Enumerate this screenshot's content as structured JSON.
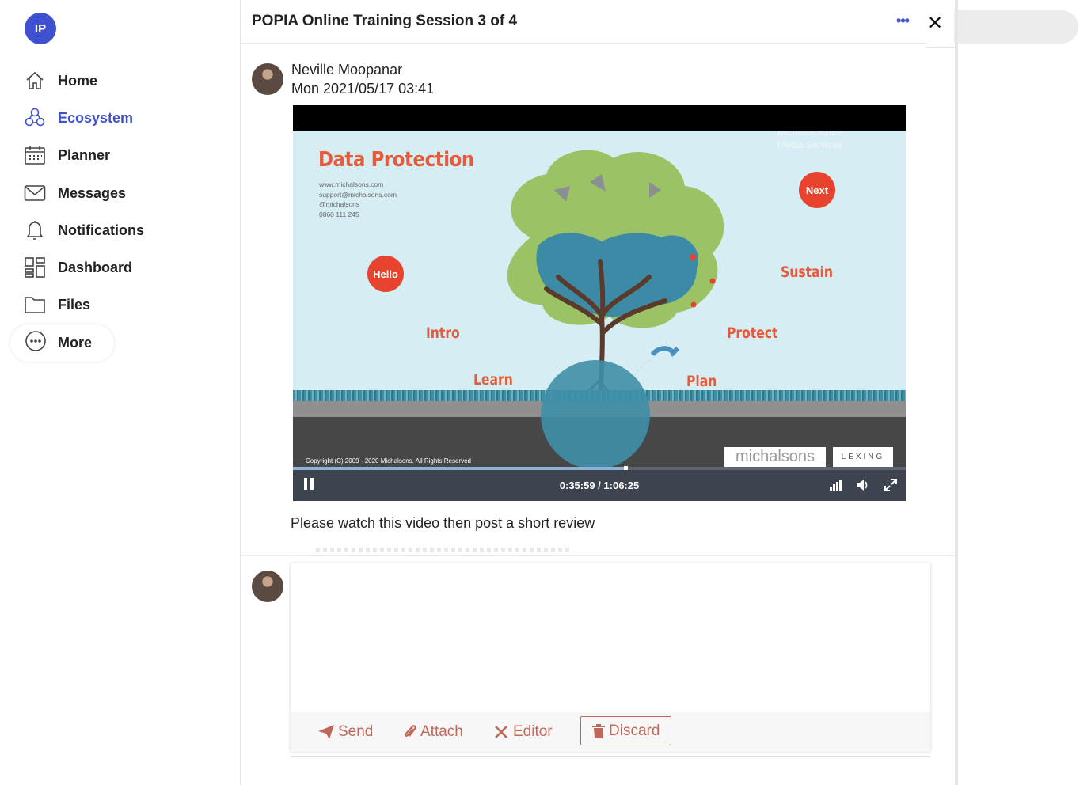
{
  "app": {
    "user_initials": "IP"
  },
  "sidebar": {
    "items": [
      {
        "label": "Home",
        "icon": "home-icon"
      },
      {
        "label": "Ecosystem",
        "icon": "ecosystem-icon",
        "active": true
      },
      {
        "label": "Planner",
        "icon": "calendar-icon"
      },
      {
        "label": "Messages",
        "icon": "mail-icon"
      },
      {
        "label": "Notifications",
        "icon": "bell-icon"
      },
      {
        "label": "Dashboard",
        "icon": "dashboard-icon"
      },
      {
        "label": "Files",
        "icon": "folder-icon"
      },
      {
        "label": "More",
        "icon": "more-icon"
      }
    ]
  },
  "panel": {
    "title": "POPIA Online Training Session 3 of 4",
    "menu_icon": "more-horizontal-icon",
    "close_icon": "close-icon"
  },
  "post": {
    "author": "Neville Moopanar",
    "date": "Mon 2021/05/17 03:41",
    "body": "Please watch this video then post a short review"
  },
  "video": {
    "slide": {
      "title": "Data Protection",
      "contact": [
        "www.michalsons.com",
        "support@michalsons.com",
        "@michalsons",
        "0860 111 245"
      ],
      "hello": "Hello",
      "next": "Next",
      "stages": {
        "intro": "Intro",
        "learn": "Learn",
        "plan": "Plan",
        "protect": "Protect",
        "sustain": "Sustain"
      },
      "watermark_line1": "Microsoft Azure",
      "watermark_line2": "Media Services",
      "copyright": "Copyright (C) 2009 - 2020 Michalsons. All Rights Reserved",
      "logo_left": "michalsons",
      "logo_right": "LEXING"
    },
    "time": "0:35:59 / 1:06:25",
    "progress": 0.542,
    "state": "playing"
  },
  "composer": {
    "text": "",
    "send": "Send",
    "attach": "Attach",
    "editor": "Editor",
    "discard": "Discard"
  },
  "colors": {
    "accent": "#3f51d1",
    "action": "#c0675a",
    "slide_red": "#e85a3a"
  }
}
